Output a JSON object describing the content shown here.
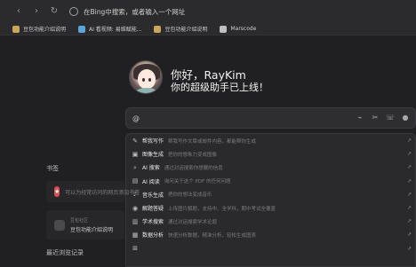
{
  "topbar": {
    "address_placeholder": "在Bing中搜索，或者输入一个网址"
  },
  "bookmarks": [
    {
      "label": "豆包功能介绍说明",
      "icon": "folder-icon",
      "color": "#caa65a"
    },
    {
      "label": "AI 看视频: 易维赋能...",
      "icon": "video-icon",
      "color": "#5aa6d6"
    },
    {
      "label": "豆包功能介绍说明",
      "icon": "folder-icon",
      "color": "#caa65a"
    },
    {
      "label": "Marscode",
      "icon": "gear-icon",
      "color": "#bfbfbf"
    }
  ],
  "greeting": {
    "line1": "你好，RayKim",
    "line2": "你的超级助手已上线！"
  },
  "input": {
    "prefix": "@"
  },
  "dropdown_items": [
    {
      "icon": "pen-icon",
      "title": "帮我写作",
      "desc": "帮我写作文章或邮件内容，都能帮你生成"
    },
    {
      "icon": "image-icon",
      "title": "图像生成",
      "desc": "把你的想象力变成图像"
    },
    {
      "icon": "search-icon",
      "title": "AI 搜索",
      "desc": "通过对话搜索你想要的信息"
    },
    {
      "icon": "doc-icon",
      "title": "AI 阅读",
      "desc": "询问关于这个 PDF 的任何问题"
    },
    {
      "icon": "music-icon",
      "title": "音乐生成",
      "desc": "把你的想法变成音乐"
    },
    {
      "icon": "camera-icon",
      "title": "解题答疑",
      "desc": "上传图片解题，支持中、全学科，期中考试全覆盖"
    },
    {
      "icon": "book-icon",
      "title": "学术搜索",
      "desc": "通过对话搜索学术论题"
    },
    {
      "icon": "table-icon",
      "title": "数据分析",
      "desc": "快速分析数据，精准分析，轻松生成图表"
    },
    {
      "icon": "grid-icon",
      "title": "",
      "desc": ""
    }
  ],
  "left_panel": {
    "section_title": "书签",
    "card1_text": "可以为经常访问的网页添加书签",
    "card2_sub": "豆包社区",
    "card2_main": "豆包功能介绍说明",
    "section_title2": "最近浏览记录"
  }
}
